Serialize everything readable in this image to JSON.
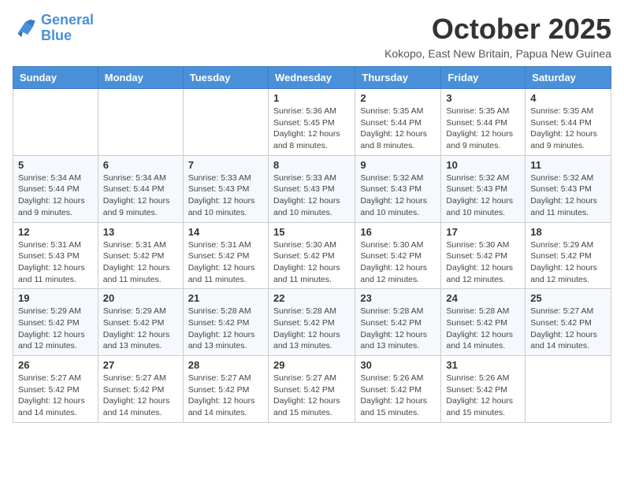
{
  "logo": {
    "line1": "General",
    "line2": "Blue"
  },
  "title": "October 2025",
  "subtitle": "Kokopo, East New Britain, Papua New Guinea",
  "headers": [
    "Sunday",
    "Monday",
    "Tuesday",
    "Wednesday",
    "Thursday",
    "Friday",
    "Saturday"
  ],
  "weeks": [
    [
      {
        "day": "",
        "info": ""
      },
      {
        "day": "",
        "info": ""
      },
      {
        "day": "",
        "info": ""
      },
      {
        "day": "1",
        "info": "Sunrise: 5:36 AM\nSunset: 5:45 PM\nDaylight: 12 hours and 8 minutes."
      },
      {
        "day": "2",
        "info": "Sunrise: 5:35 AM\nSunset: 5:44 PM\nDaylight: 12 hours and 8 minutes."
      },
      {
        "day": "3",
        "info": "Sunrise: 5:35 AM\nSunset: 5:44 PM\nDaylight: 12 hours and 9 minutes."
      },
      {
        "day": "4",
        "info": "Sunrise: 5:35 AM\nSunset: 5:44 PM\nDaylight: 12 hours and 9 minutes."
      }
    ],
    [
      {
        "day": "5",
        "info": "Sunrise: 5:34 AM\nSunset: 5:44 PM\nDaylight: 12 hours and 9 minutes."
      },
      {
        "day": "6",
        "info": "Sunrise: 5:34 AM\nSunset: 5:44 PM\nDaylight: 12 hours and 9 minutes."
      },
      {
        "day": "7",
        "info": "Sunrise: 5:33 AM\nSunset: 5:43 PM\nDaylight: 12 hours and 10 minutes."
      },
      {
        "day": "8",
        "info": "Sunrise: 5:33 AM\nSunset: 5:43 PM\nDaylight: 12 hours and 10 minutes."
      },
      {
        "day": "9",
        "info": "Sunrise: 5:32 AM\nSunset: 5:43 PM\nDaylight: 12 hours and 10 minutes."
      },
      {
        "day": "10",
        "info": "Sunrise: 5:32 AM\nSunset: 5:43 PM\nDaylight: 12 hours and 10 minutes."
      },
      {
        "day": "11",
        "info": "Sunrise: 5:32 AM\nSunset: 5:43 PM\nDaylight: 12 hours and 11 minutes."
      }
    ],
    [
      {
        "day": "12",
        "info": "Sunrise: 5:31 AM\nSunset: 5:43 PM\nDaylight: 12 hours and 11 minutes."
      },
      {
        "day": "13",
        "info": "Sunrise: 5:31 AM\nSunset: 5:42 PM\nDaylight: 12 hours and 11 minutes."
      },
      {
        "day": "14",
        "info": "Sunrise: 5:31 AM\nSunset: 5:42 PM\nDaylight: 12 hours and 11 minutes."
      },
      {
        "day": "15",
        "info": "Sunrise: 5:30 AM\nSunset: 5:42 PM\nDaylight: 12 hours and 11 minutes."
      },
      {
        "day": "16",
        "info": "Sunrise: 5:30 AM\nSunset: 5:42 PM\nDaylight: 12 hours and 12 minutes."
      },
      {
        "day": "17",
        "info": "Sunrise: 5:30 AM\nSunset: 5:42 PM\nDaylight: 12 hours and 12 minutes."
      },
      {
        "day": "18",
        "info": "Sunrise: 5:29 AM\nSunset: 5:42 PM\nDaylight: 12 hours and 12 minutes."
      }
    ],
    [
      {
        "day": "19",
        "info": "Sunrise: 5:29 AM\nSunset: 5:42 PM\nDaylight: 12 hours and 12 minutes."
      },
      {
        "day": "20",
        "info": "Sunrise: 5:29 AM\nSunset: 5:42 PM\nDaylight: 12 hours and 13 minutes."
      },
      {
        "day": "21",
        "info": "Sunrise: 5:28 AM\nSunset: 5:42 PM\nDaylight: 12 hours and 13 minutes."
      },
      {
        "day": "22",
        "info": "Sunrise: 5:28 AM\nSunset: 5:42 PM\nDaylight: 12 hours and 13 minutes."
      },
      {
        "day": "23",
        "info": "Sunrise: 5:28 AM\nSunset: 5:42 PM\nDaylight: 12 hours and 13 minutes."
      },
      {
        "day": "24",
        "info": "Sunrise: 5:28 AM\nSunset: 5:42 PM\nDaylight: 12 hours and 14 minutes."
      },
      {
        "day": "25",
        "info": "Sunrise: 5:27 AM\nSunset: 5:42 PM\nDaylight: 12 hours and 14 minutes."
      }
    ],
    [
      {
        "day": "26",
        "info": "Sunrise: 5:27 AM\nSunset: 5:42 PM\nDaylight: 12 hours and 14 minutes."
      },
      {
        "day": "27",
        "info": "Sunrise: 5:27 AM\nSunset: 5:42 PM\nDaylight: 12 hours and 14 minutes."
      },
      {
        "day": "28",
        "info": "Sunrise: 5:27 AM\nSunset: 5:42 PM\nDaylight: 12 hours and 14 minutes."
      },
      {
        "day": "29",
        "info": "Sunrise: 5:27 AM\nSunset: 5:42 PM\nDaylight: 12 hours and 15 minutes."
      },
      {
        "day": "30",
        "info": "Sunrise: 5:26 AM\nSunset: 5:42 PM\nDaylight: 12 hours and 15 minutes."
      },
      {
        "day": "31",
        "info": "Sunrise: 5:26 AM\nSunset: 5:42 PM\nDaylight: 12 hours and 15 minutes."
      },
      {
        "day": "",
        "info": ""
      }
    ]
  ]
}
